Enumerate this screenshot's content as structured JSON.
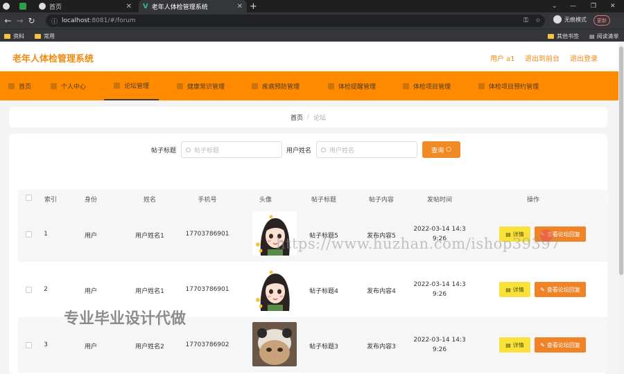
{
  "browser": {
    "tabs": [
      {
        "label": ""
      },
      {
        "label": ""
      },
      {
        "label": "首页"
      },
      {
        "label": "老年人体检管理系统"
      }
    ],
    "url_host": "localhost",
    "url_rest": ":8081/#/forum",
    "incognito_label": "无痕模式",
    "update_label": "更新",
    "bookmarks": [
      "资料",
      "常用"
    ],
    "bookmarks_right": [
      "其他书签",
      "阅读清单"
    ]
  },
  "header": {
    "title": "老年人体检管理系统",
    "user": "用户 a1",
    "back_front": "退出到前台",
    "logout": "退出登录"
  },
  "menu": [
    "首页",
    "个人中心",
    "论坛管理",
    "健康常识管理",
    "疾病预防管理",
    "体检提醒管理",
    "体检项目管理",
    "体检项目预约管理"
  ],
  "breadcrumb": {
    "home": "首页",
    "sep": "/",
    "current": "论坛"
  },
  "search": {
    "title_label": "帖子标题",
    "title_placeholder": "帖子标题",
    "name_label": "用户姓名",
    "name_placeholder": "用户姓名",
    "button": "查询"
  },
  "table": {
    "headers": [
      "索引",
      "身份",
      "姓名",
      "手机号",
      "头像",
      "帖子标题",
      "帖子内容",
      "发帖时间",
      "操作"
    ],
    "rows": [
      {
        "index": "1",
        "role": "用户",
        "name": "用户姓名1",
        "phone": "17703786901",
        "title": "帖子标题5",
        "content": "发布内容5",
        "time1": "2022-03-14 14:3",
        "time2": "9:26"
      },
      {
        "index": "2",
        "role": "用户",
        "name": "用户姓名1",
        "phone": "17703786901",
        "title": "帖子标题4",
        "content": "发布内容4",
        "time1": "2022-03-14 14:3",
        "time2": "9:26"
      },
      {
        "index": "3",
        "role": "用户",
        "name": "用户姓名2",
        "phone": "17703786902",
        "title": "帖子标题3",
        "content": "发布内容3",
        "time1": "2022-03-14 14:3",
        "time2": "9:26"
      }
    ],
    "detail_button": "详情",
    "reply_button": "查看论坛回复"
  },
  "watermark": {
    "url": "https://www.huzhan.com/ishop39397",
    "text": "专业毕业设计代做"
  },
  "colors": {
    "brand": "#f08a10",
    "menu_bg": "#ff8a00",
    "detail_btn": "#f8e13a",
    "reply_btn": "#ef8327"
  }
}
